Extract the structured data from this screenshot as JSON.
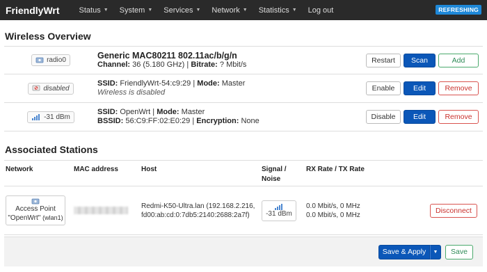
{
  "nav": {
    "brand": "FriendlyWrt",
    "items": [
      {
        "label": "Status",
        "dropdown": true
      },
      {
        "label": "System",
        "dropdown": true
      },
      {
        "label": "Services",
        "dropdown": true
      },
      {
        "label": "Network",
        "dropdown": true
      },
      {
        "label": "Statistics",
        "dropdown": true
      },
      {
        "label": "Log out",
        "dropdown": false
      }
    ],
    "refresh_badge": "REFRESHING"
  },
  "wireless": {
    "title": "Wireless Overview",
    "radio": {
      "chip": "radio0",
      "name": "Generic MAC80211 802.11ac/b/g/n",
      "channel_label": "Channel:",
      "channel_value": "36 (5.180 GHz)",
      "bitrate_label": "Bitrate:",
      "bitrate_value": "? Mbit/s",
      "buttons": {
        "restart": "Restart",
        "scan": "Scan",
        "add": "Add"
      }
    },
    "networks": [
      {
        "chip": "disabled",
        "ssid_label": "SSID:",
        "ssid_value": "FriendlyWrt-54:c9:29",
        "mode_label": "Mode:",
        "mode_value": "Master",
        "line2": "Wireless is disabled",
        "buttons": {
          "toggle": "Enable",
          "edit": "Edit",
          "remove": "Remove"
        }
      },
      {
        "chip": "-31 dBm",
        "ssid_label": "SSID:",
        "ssid_value": "OpenWrt",
        "mode_label": "Mode:",
        "mode_value": "Master",
        "bssid_label": "BSSID:",
        "bssid_value": "56:C9:FF:02:E0:29",
        "enc_label": "Encryption:",
        "enc_value": "None",
        "buttons": {
          "toggle": "Disable",
          "edit": "Edit",
          "remove": "Remove"
        }
      }
    ]
  },
  "stations": {
    "title": "Associated Stations",
    "headers": {
      "network": "Network",
      "mac": "MAC address",
      "host": "Host",
      "signal_1": "Signal /",
      "signal_2": "Noise",
      "rate": "RX Rate / TX Rate"
    },
    "row": {
      "ap_line1": "Access Point",
      "ap_ssid": "\"OpenWrt\"",
      "ap_iface": "(wlan1)",
      "host_line1": "Redmi-K50-Ultra.lan (192.168.2.216,",
      "host_line2": "fd00:ab:cd:0:7db5:2140:2688:2a7f)",
      "signal": "-31 dBm",
      "rx": "0.0 Mbit/s, 0 MHz",
      "tx": "0.0 Mbit/s, 0 MHz",
      "disconnect": "Disconnect"
    }
  },
  "footer": {
    "save_apply": "Save & Apply",
    "save": "Save"
  },
  "colors": {
    "navbar": "#2a2a2a",
    "primary": "#0b57b8",
    "refresh": "#1e88d8",
    "success": "#2e8b57",
    "danger": "#c9302c"
  }
}
